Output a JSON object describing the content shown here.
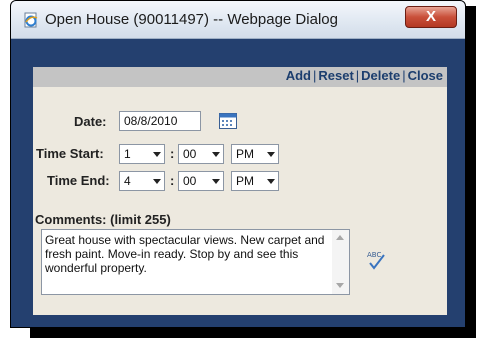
{
  "window": {
    "title": "Open House (90011497) -- Webpage Dialog",
    "close_label": "X"
  },
  "actions": {
    "add": "Add",
    "reset": "Reset",
    "delete": "Delete",
    "close": "Close",
    "separator": "|"
  },
  "form": {
    "date_label": "Date:",
    "date_value": "08/8/2010",
    "time_start_label": "Time Start:",
    "time_start": {
      "hour": "1",
      "minute": "00",
      "ampm": "PM"
    },
    "time_end_label": "Time End:",
    "time_end": {
      "hour": "4",
      "minute": "00",
      "ampm": "PM"
    },
    "colon": ":",
    "comments_label": "Comments: (limit 255)",
    "comments_value": "Great house with spectacular views.  New carpet and fresh paint.  Move-in ready.  Stop by and see this wonderful property."
  },
  "icons": {
    "title": "ie-page-icon",
    "calendar": "calendar-icon",
    "spellcheck": "spellcheck-icon"
  },
  "colors": {
    "frame": "#24406f",
    "panel": "#ede9df",
    "link": "#1c3e6e",
    "close_button": "#c9503a"
  }
}
